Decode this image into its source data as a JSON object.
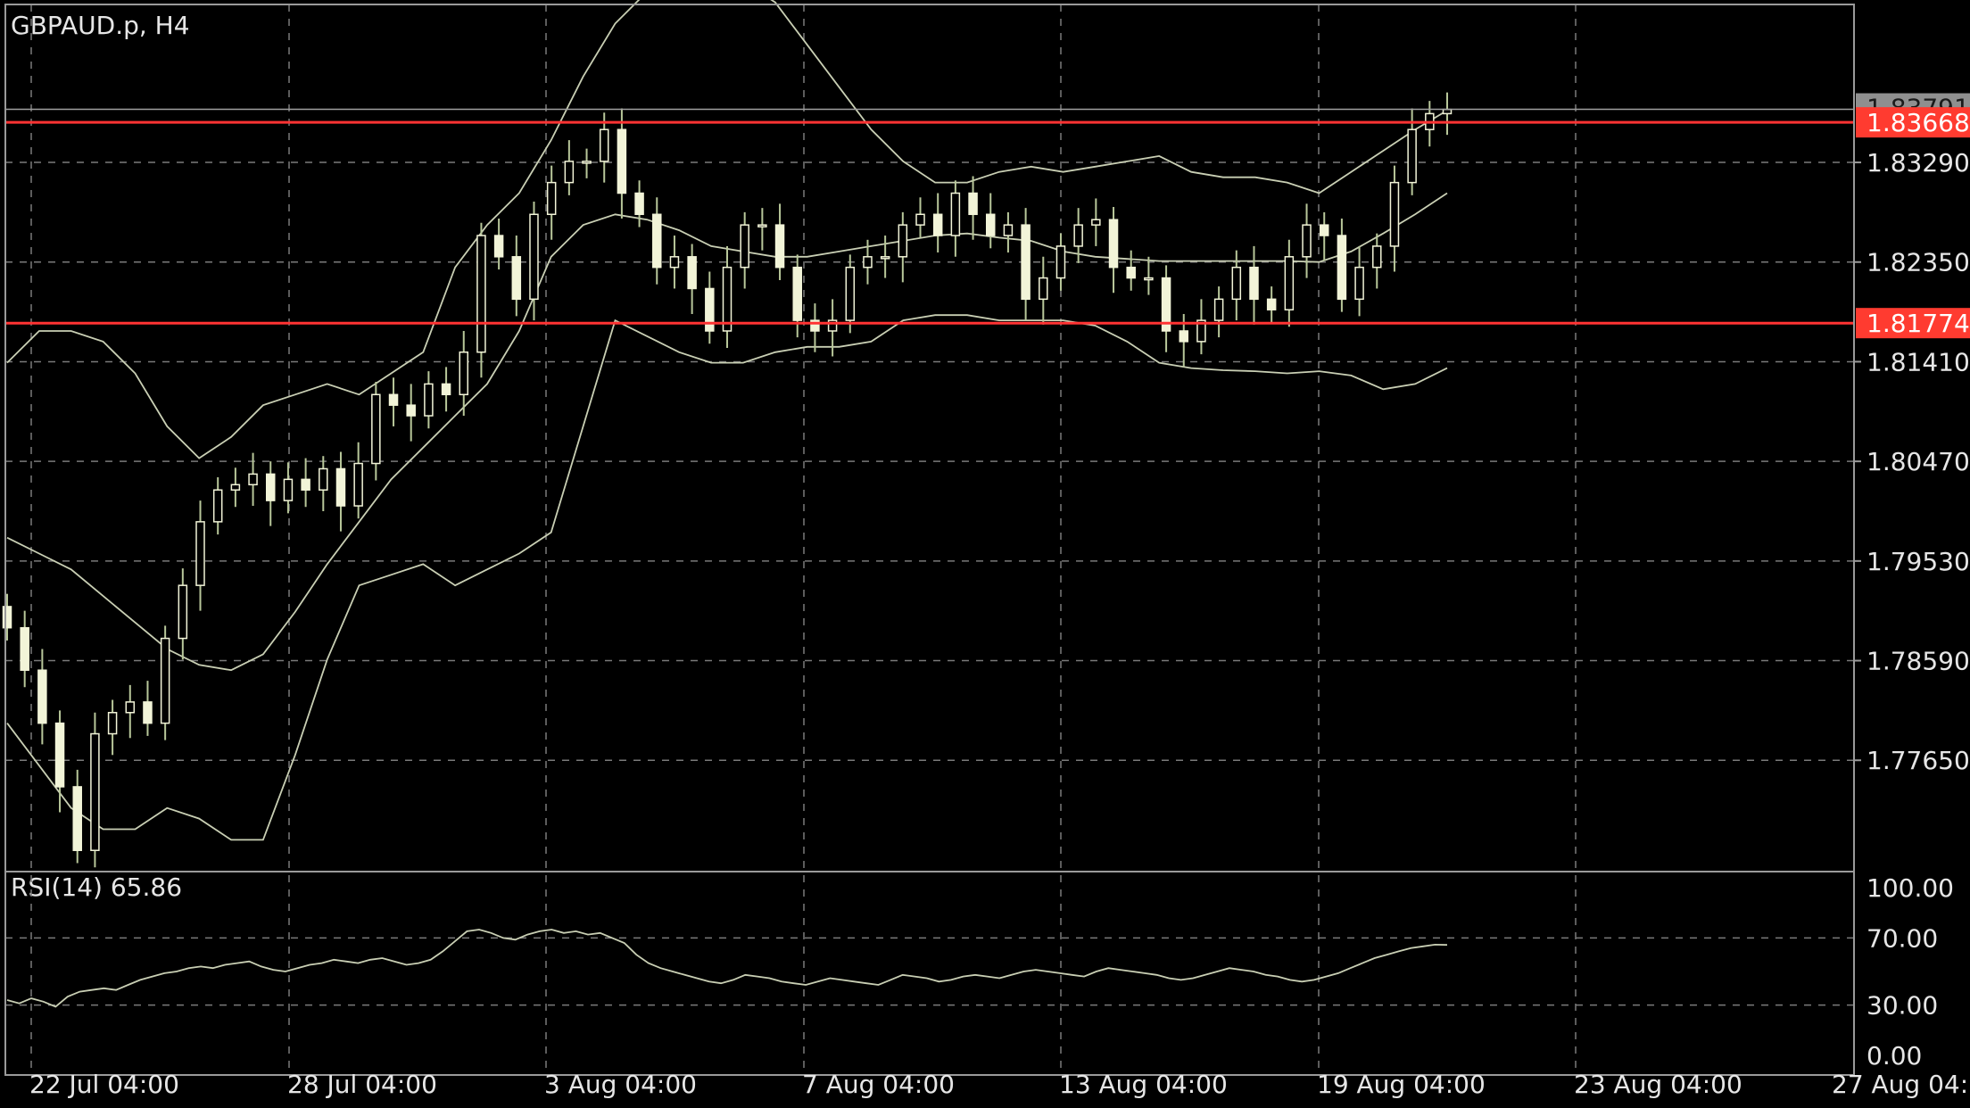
{
  "header": {
    "symbol_timeframe": "GBPAUD.p, H4"
  },
  "rsi_panel": {
    "title": "RSI(14) 65.86"
  },
  "colors": {
    "background": "#000000",
    "grid": "#7a7a7a",
    "candle": "#f2f4d8",
    "wick": "#b8c79a",
    "band": "#c9cfb4",
    "level": "#ff3333",
    "level_label": "#ff3b30",
    "bid_label": "#8f8f8f"
  },
  "chart_data": [
    {
      "type": "candlestick",
      "title": "GBPAUD.p, H4",
      "indicator": "Bollinger Bands",
      "ylim": [
        1.766,
        1.8478
      ],
      "y_ticks": [
        "1.83290",
        "1.82350",
        "1.81410",
        "1.80470",
        "1.79530",
        "1.78590",
        "1.77650"
      ],
      "x_ticks": [
        "22 Jul 04:00",
        "28 Jul 04:00",
        "3 Aug 04:00",
        "7 Aug 04:00",
        "13 Aug 04:00",
        "19 Aug 04:00",
        "23 Aug 04:00",
        "27 Aug 04:"
      ],
      "horizontal_levels": [
        {
          "price": 1.83668,
          "label": "1.83668"
        },
        {
          "price": 1.81774,
          "label": "1.81774"
        }
      ],
      "current_price": {
        "price": 1.83791,
        "label": "1.83791"
      },
      "closes": [
        1.789,
        1.785,
        1.78,
        1.774,
        1.768,
        1.779,
        1.781,
        1.782,
        1.78,
        1.788,
        1.793,
        1.799,
        1.802,
        1.8025,
        1.8035,
        1.801,
        1.803,
        1.802,
        1.804,
        1.8005,
        1.8045,
        1.811,
        1.81,
        1.809,
        1.812,
        1.811,
        1.815,
        1.826,
        1.824,
        1.82,
        1.828,
        1.831,
        1.833,
        1.833,
        1.836,
        1.83,
        1.828,
        1.823,
        1.824,
        1.821,
        1.817,
        1.823,
        1.827,
        1.827,
        1.823,
        1.818,
        1.817,
        1.818,
        1.823,
        1.824,
        1.824,
        1.827,
        1.828,
        1.826,
        1.83,
        1.828,
        1.826,
        1.827,
        1.82,
        1.822,
        1.825,
        1.827,
        1.8275,
        1.823,
        1.822,
        1.822,
        1.817,
        1.816,
        1.818,
        1.82,
        1.823,
        1.82,
        1.819,
        1.824,
        1.827,
        1.826,
        1.82,
        1.823,
        1.825,
        1.831,
        1.836,
        1.8375,
        1.8379
      ],
      "bollinger_upper": [
        1.814,
        1.817,
        1.817,
        1.816,
        1.813,
        1.808,
        1.805,
        1.807,
        1.81,
        1.811,
        1.812,
        1.811,
        1.813,
        1.815,
        1.823,
        1.827,
        1.83,
        1.835,
        1.841,
        1.846,
        1.849,
        1.85,
        1.851,
        1.85,
        1.848,
        1.844,
        1.84,
        1.836,
        1.833,
        1.831,
        1.831,
        1.832,
        1.8325,
        1.832,
        1.8325,
        1.833,
        1.8335,
        1.832,
        1.8315,
        1.8315,
        1.831,
        1.83,
        1.832,
        1.834,
        1.836,
        1.8378
      ],
      "bollinger_middle": [
        1.7975,
        1.796,
        1.7945,
        1.792,
        1.7895,
        1.787,
        1.7855,
        1.785,
        1.7865,
        1.7905,
        1.795,
        1.799,
        1.803,
        1.806,
        1.809,
        1.812,
        1.817,
        1.824,
        1.827,
        1.828,
        1.8275,
        1.8265,
        1.825,
        1.8245,
        1.824,
        1.824,
        1.8245,
        1.825,
        1.8255,
        1.826,
        1.8262,
        1.8258,
        1.8255,
        1.8245,
        1.824,
        1.8238,
        1.8236,
        1.8236,
        1.8236,
        1.8236,
        1.8236,
        1.8235,
        1.8245,
        1.8262,
        1.828,
        1.83
      ],
      "bollinger_lower": [
        1.78,
        1.776,
        1.772,
        1.77,
        1.77,
        1.772,
        1.771,
        1.769,
        1.769,
        1.777,
        1.786,
        1.793,
        1.794,
        1.795,
        1.793,
        1.7945,
        1.796,
        1.798,
        1.808,
        1.818,
        1.8165,
        1.815,
        1.814,
        1.814,
        1.815,
        1.8155,
        1.8155,
        1.816,
        1.818,
        1.8185,
        1.8185,
        1.818,
        1.818,
        1.818,
        1.8175,
        1.816,
        1.814,
        1.8135,
        1.8133,
        1.8132,
        1.813,
        1.8132,
        1.8128,
        1.8115,
        1.812,
        1.8135
      ]
    },
    {
      "type": "line",
      "title": "RSI(14) 65.86",
      "ylim": [
        0,
        100
      ],
      "y_ticks": [
        "100.00",
        "70.00",
        "30.00",
        "0.00"
      ],
      "levels": [
        70,
        30
      ],
      "values": [
        33,
        31,
        34,
        32,
        29,
        35,
        38,
        39,
        40,
        39,
        42,
        45,
        47,
        49,
        50,
        52,
        53,
        52,
        54,
        55,
        56,
        53,
        51,
        50,
        52,
        54,
        55,
        57,
        56,
        55,
        57,
        58,
        56,
        54,
        55,
        57,
        62,
        68,
        74,
        75,
        73,
        70,
        69,
        72,
        74,
        75,
        73,
        74,
        72,
        73,
        70,
        67,
        60,
        55,
        52,
        50,
        48,
        46,
        44,
        43,
        45,
        48,
        47,
        46,
        44,
        43,
        42,
        44,
        46,
        45,
        44,
        43,
        42,
        45,
        48,
        47,
        46,
        44,
        45,
        47,
        48,
        47,
        46,
        48,
        50,
        51,
        50,
        49,
        48,
        47,
        50,
        52,
        51,
        50,
        49,
        48,
        46,
        45,
        46,
        48,
        50,
        52,
        51,
        50,
        48,
        47,
        45,
        44,
        45,
        47,
        49,
        52,
        55,
        58,
        60,
        62,
        64,
        65,
        66,
        65.86
      ]
    }
  ]
}
